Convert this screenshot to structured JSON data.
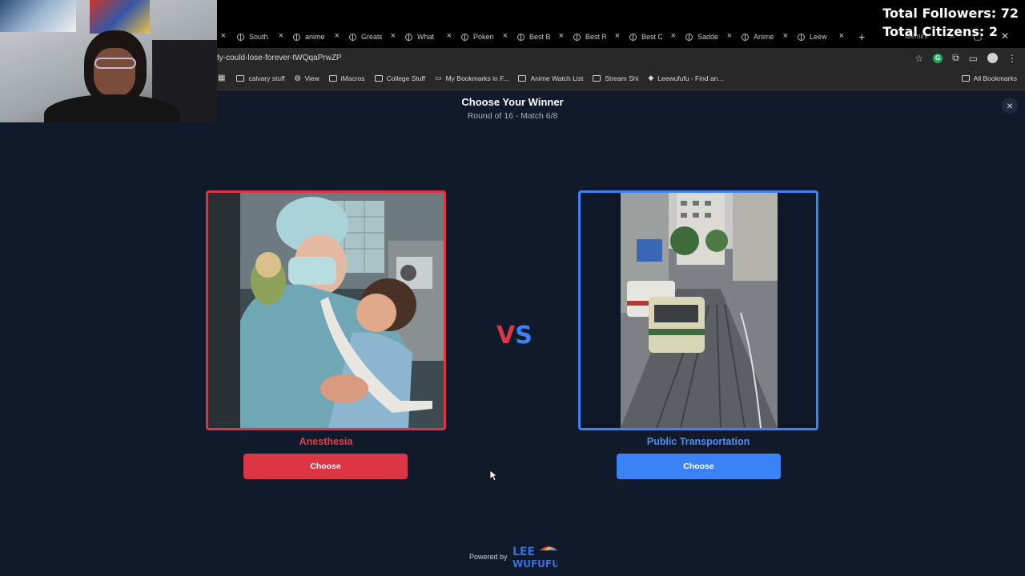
{
  "browser": {
    "tabs": [
      {
        "label": ""
      },
      {
        "label": "South"
      },
      {
        "label": "anime"
      },
      {
        "label": "Greate"
      },
      {
        "label": "What"
      },
      {
        "label": "Poken"
      },
      {
        "label": "Best B"
      },
      {
        "label": "Best R"
      },
      {
        "label": "Best C"
      },
      {
        "label": "Sadde"
      },
      {
        "label": "Anime"
      },
      {
        "label": "Leew"
      }
    ],
    "new_tab_glyph": "+",
    "gemini_label": "Gemini",
    "url": "ty-could-lose-forever-tWQqaPrwZP",
    "bookmarks": [
      {
        "label": "calvary stuff",
        "icon": "folder-icon"
      },
      {
        "label": "View",
        "icon": "globe-icon"
      },
      {
        "label": "iMacros",
        "icon": "folder-icon"
      },
      {
        "label": "College Stuff",
        "icon": "folder-icon"
      },
      {
        "label": "My Bookmarks in F...",
        "icon": "film-icon"
      },
      {
        "label": "Anime Watch List",
        "icon": "folder-icon"
      },
      {
        "label": "Stream Shi",
        "icon": "folder-icon"
      },
      {
        "label": "Leewufufu - Find an...",
        "icon": "site-icon"
      }
    ],
    "all_bookmarks": "All Bookmarks"
  },
  "overlay": {
    "followers": "Total Followers: 72",
    "citizens": "Total Citizens: 2"
  },
  "header": {
    "title": "Choose Your Winner",
    "subtitle": "Round of 16 - Match 6/8",
    "close_glyph": "×"
  },
  "matchup": {
    "left": {
      "name": "Anesthesia",
      "button": "Choose",
      "color": "#dc3545"
    },
    "right": {
      "name": "Public Transportation",
      "button": "Choose",
      "color": "#3b82f6"
    },
    "vs_v": "V",
    "vs_s": "S"
  },
  "footer": {
    "powered_by": "Powered by",
    "logo_line1": "LEE",
    "logo_line2": "WUFUFU"
  }
}
